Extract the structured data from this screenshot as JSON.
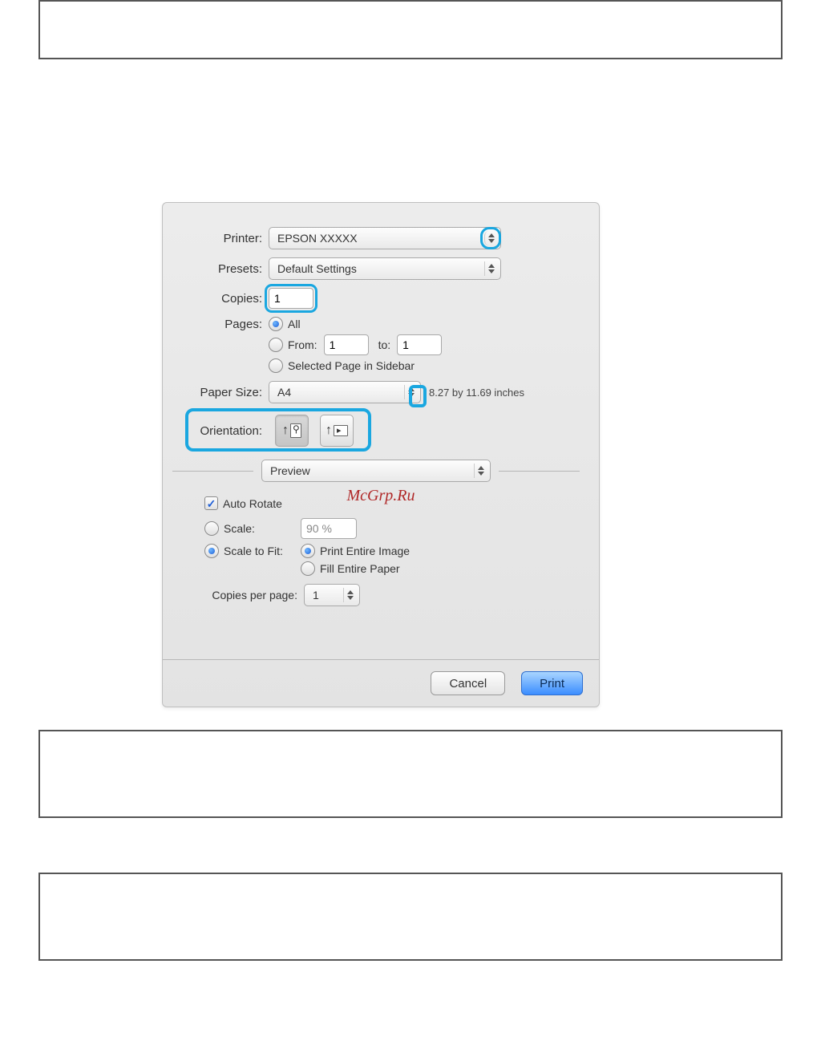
{
  "labels": {
    "printer": "Printer:",
    "presets": "Presets:",
    "copies": "Copies:",
    "pages": "Pages:",
    "from": "From:",
    "to": "to:",
    "paper_size": "Paper Size:",
    "orientation": "Orientation:",
    "copies_per_page": "Copies per page:"
  },
  "printer": {
    "value": "EPSON XXXXX"
  },
  "presets": {
    "value": "Default Settings"
  },
  "copies": {
    "value": "1"
  },
  "pages": {
    "all": "All",
    "from_value": "1",
    "to_value": "1",
    "selected_sidebar": "Selected Page in Sidebar"
  },
  "paper_size": {
    "value": "A4",
    "dimensions": "8.27 by 11.69 inches"
  },
  "panel": {
    "value": "Preview"
  },
  "preview": {
    "auto_rotate": "Auto Rotate",
    "scale_label": "Scale:",
    "scale_value": "90 %",
    "scale_to_fit": "Scale to Fit:",
    "print_entire": "Print Entire Image",
    "fill_paper": "Fill Entire Paper",
    "copies_per_page_value": "1"
  },
  "footer": {
    "cancel": "Cancel",
    "print": "Print"
  },
  "watermark": "McGrp.Ru"
}
